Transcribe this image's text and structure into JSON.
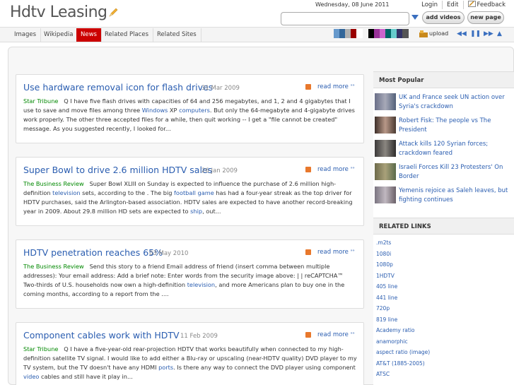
{
  "header": {
    "logo": "Hdtv Leasing",
    "date": "Wednesday, 08 June 2011",
    "links": [
      "Login",
      "Edit",
      "Feedback"
    ],
    "search_value": "",
    "add_videos": "add videos",
    "new_page": "new page"
  },
  "nav": {
    "tabs": [
      "Images",
      "Wikipedia",
      "News",
      "Related Places",
      "Related Sites"
    ],
    "active": "News",
    "upload": "upload",
    "swatch_colors": [
      "#6699cc",
      "#336699",
      "#b0b0b0",
      "#990000",
      "#ffffff",
      "#000000",
      "#993399",
      "#cc66cc",
      "#006666",
      "#66cccc",
      "#333366",
      "#555555"
    ]
  },
  "articles": [
    {
      "title": "Use hardware removal icon for flash drives",
      "date": "31 Mar 2009",
      "source": "Star Tribune",
      "b1": "Q I have five flash drives with capacities of 64 and 256 megabytes, and 1, 2 and 4 gigabytes that I use to save and move files among three ",
      "l1": "Windows",
      "b2": " XP ",
      "l2": "computers",
      "b3": ". But only the 64-megabyte and 4-gigabyte drives work properly. The other three accepted files for a while, then quit working -- I get a \"file cannot be created\" message. As you suggested recently, I looked for...",
      "more": "read more"
    },
    {
      "title": "Super Bowl to drive 2.6 million HDTV sales",
      "date": "26 Jan 2009",
      "source": "The Business Review",
      "b1": "Super Bowl XLIII on Sunday is expected to influence the purchase of 2.6 million high-definition ",
      "l1": "television",
      "b2": " sets, according to the . The big ",
      "l2": "football game",
      "b3": " has had a four-year streak as the top driver for HDTV purchases, said the Arlington-based association. HDTV sales are expected to have another record-breaking year in 2009. About 29.8 million HD sets are expected to ",
      "l3": "ship",
      "b4": ", out...",
      "more": "read more"
    },
    {
      "title": "HDTV penetration reaches 65%",
      "date": "03 May 2010",
      "source": "The Business Review",
      "b1": "Send this story to a friend Email address of friend (insert comma between multiple addresses): Your email address: Add a brief note: Enter words from the security image above: | | reCAPTCHA™ Two-thirds of U.S. households now own a high-definition ",
      "l1": "television",
      "b2": ", and more Americans plan to buy one in the coming months, according to a report from the ....",
      "more": "read more"
    },
    {
      "title": "Component cables work with HDTV",
      "date": "11 Feb 2009",
      "source": "Star Tribune",
      "b1": "Q I have a five-year-old rear-projection HDTV that works beautifully when connected to my high-definition satellite TV signal. I would like to add either a Blu-ray or upscaling (near-HDTV quality) DVD player to my TV system, but the TV doesn't have any HDMI ",
      "l1": "ports",
      "b2": ". Is there any way to connect the DVD player using component ",
      "l2": "video",
      "b3": " cables and still have it play in...",
      "more": "read more"
    }
  ],
  "sidebar": {
    "popular_heading": "Most Popular",
    "popular": [
      "UK and France seek UN action over Syria's crackdown",
      "Robert Fisk: The people vs The President",
      "Attack kills 120 Syrian forces; crackdown feared",
      "Israeli Forces Kill 23 Protesters' On Border",
      "Yemenis rejoice as Saleh leaves, but fighting continues"
    ],
    "related_heading": "RELATED LINKS",
    "related": [
      ".m2ts",
      "1080i",
      "1080p",
      "1HDTV",
      "405 line",
      "441 line",
      "720p",
      "819 line",
      "Academy ratio",
      "anamorphic",
      "aspect ratio (image)",
      "AT&T (1885-2005)",
      "ATSC"
    ]
  }
}
